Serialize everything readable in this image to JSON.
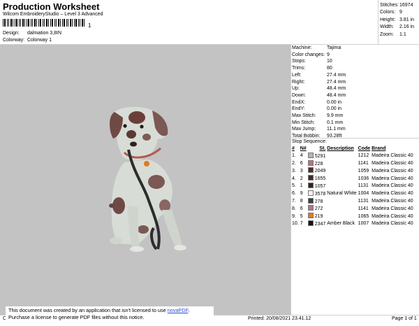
{
  "header": {
    "title": "Production Worksheet",
    "subtitle": "Wilcom EmbroideryStudio – Level 3 Advanced",
    "barcode_caption": "1",
    "design_label": "Design:",
    "design_value": "dalmation 3,8IN",
    "colorway_label": "Colorway:",
    "colorway_value": "Colorway 1"
  },
  "stats": [
    {
      "label": "Stitches:",
      "value": "16974"
    },
    {
      "label": "Colors:",
      "value": "9"
    },
    {
      "label": "Height:",
      "value": "3.81 in"
    },
    {
      "label": "Width:",
      "value": "2.16 in"
    },
    {
      "label": "Zoom:",
      "value": "1:1"
    }
  ],
  "specs": [
    {
      "label": "Machine:",
      "value": "Tajima"
    },
    {
      "label": "Color changes:",
      "value": "9"
    },
    {
      "label": "Stops:",
      "value": "10"
    },
    {
      "label": "Trims:",
      "value": "80"
    },
    {
      "label": "Left:",
      "value": "27.4 mm"
    },
    {
      "label": "Right:",
      "value": "27.4 mm"
    },
    {
      "label": "Up:",
      "value": "48.4 mm"
    },
    {
      "label": "Down:",
      "value": "48.4 mm"
    },
    {
      "label": "EndX:",
      "value": "0.00 in"
    },
    {
      "label": "EndY:",
      "value": "0.00 in"
    },
    {
      "label": "Max Stitch:",
      "value": "9.9 mm"
    },
    {
      "label": "Min Stitch:",
      "value": "0.1 mm"
    },
    {
      "label": "Max Jump:",
      "value": "11.1 mm"
    },
    {
      "label": "Total Bobbin:",
      "value": "93.28ft"
    }
  ],
  "stop_sequence": {
    "heading": "Stop Sequence:",
    "columns": [
      "#",
      "N#",
      "St.",
      "Description",
      "Code",
      "Brand"
    ],
    "rows": [
      {
        "idx": "1.",
        "n": "4",
        "color": "#b9b3ab",
        "st": "5291",
        "desc": "",
        "code": "1212",
        "brand": "Madeira Classic 40"
      },
      {
        "idx": "2.",
        "n": "6",
        "color": "#b7767c",
        "st": "228",
        "desc": "",
        "code": "1141",
        "brand": "Madeira Classic 40"
      },
      {
        "idx": "3.",
        "n": "3",
        "color": "#4a2f2c",
        "st": "2049",
        "desc": "",
        "code": "1059",
        "brand": "Madeira Classic 40"
      },
      {
        "idx": "4.",
        "n": "2",
        "color": "#3a2c28",
        "st": "1655",
        "desc": "",
        "code": "1036",
        "brand": "Madeira Classic 40"
      },
      {
        "idx": "5.",
        "n": "1",
        "color": "#2c2623",
        "st": "1057",
        "desc": "",
        "code": "1131",
        "brand": "Madeira Classic 40"
      },
      {
        "idx": "6.",
        "n": "9",
        "color": "#f2f2f2",
        "st": "3578",
        "desc": "Natural White",
        "code": "1004",
        "brand": "Madeira Classic 40"
      },
      {
        "idx": "7.",
        "n": "8",
        "color": "#3d3d3d",
        "st": "278",
        "desc": "",
        "code": "1131",
        "brand": "Madeira Classic 40"
      },
      {
        "idx": "8.",
        "n": "6",
        "color": "#b7767c",
        "st": "272",
        "desc": "",
        "code": "1141",
        "brand": "Madeira Classic 40"
      },
      {
        "idx": "9.",
        "n": "5",
        "color": "#e07b22",
        "st": "219",
        "desc": "",
        "code": "1065",
        "brand": "Madeira Classic 40"
      },
      {
        "idx": "10.",
        "n": "7",
        "color": "#151515",
        "st": "2347",
        "desc": "Amber Black",
        "code": "1007",
        "brand": "Madeira Classic 40"
      }
    ]
  },
  "footer": {
    "cr": "Cr",
    "printed": "Printed: 20/08/2021 23.41.12",
    "page": "Page 1 of 1"
  },
  "notice": {
    "line1_a": "This document was created by an application that isn't licensed to use ",
    "link": "novaPDF",
    "line1_b": ".",
    "line2": "Purchase a license to generate PDF files without this notice."
  },
  "design_image": "embroidered-dalmatian-dog-with-leash"
}
